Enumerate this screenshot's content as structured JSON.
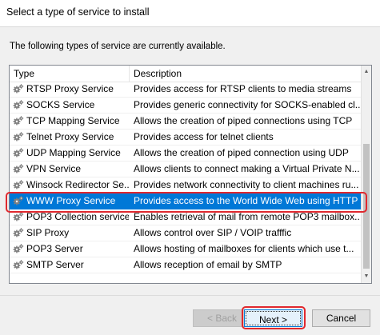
{
  "header": {
    "title": "Select a type of service to install"
  },
  "intro": "The following types of service are currently available.",
  "columns": {
    "type": "Type",
    "description": "Description"
  },
  "rows": [
    {
      "type": "RTSP Proxy Service",
      "description": "Provides access for RTSP clients to media streams",
      "selected": false
    },
    {
      "type": "SOCKS Service",
      "description": "Provides generic connectivity for SOCKS-enabled cl...",
      "selected": false
    },
    {
      "type": "TCP Mapping Service",
      "description": "Allows the creation of piped connections using TCP",
      "selected": false
    },
    {
      "type": "Telnet Proxy Service",
      "description": "Provides access for telnet clients",
      "selected": false
    },
    {
      "type": "UDP Mapping Service",
      "description": "Allows the creation of piped connection using UDP",
      "selected": false
    },
    {
      "type": "VPN Service",
      "description": "Allows clients to connect making a Virtual Private N...",
      "selected": false
    },
    {
      "type": "Winsock Redirector Se...",
      "description": "Provides network connectivity to client machines ru...",
      "selected": false
    },
    {
      "type": "WWW Proxy Service",
      "description": "Provides access to the World Wide Web using HTTP",
      "selected": true
    },
    {
      "type": "POP3 Collection service",
      "description": "Enables retrieval of mail from remote POP3 mailbox...",
      "selected": false
    },
    {
      "type": "SIP Proxy",
      "description": "Allows control over SIP / VOIP trafffic",
      "selected": false
    },
    {
      "type": "POP3 Server",
      "description": "Allows hosting of mailboxes for clients which use t...",
      "selected": false
    },
    {
      "type": "SMTP Server",
      "description": "Allows reception of email by SMTP",
      "selected": false
    }
  ],
  "row_icon": "gear-service-icon",
  "buttons": {
    "back": "< Back",
    "next": "Next >",
    "cancel": "Cancel"
  },
  "colors": {
    "selection": "#0078d7",
    "highlight": "#e0282e"
  }
}
